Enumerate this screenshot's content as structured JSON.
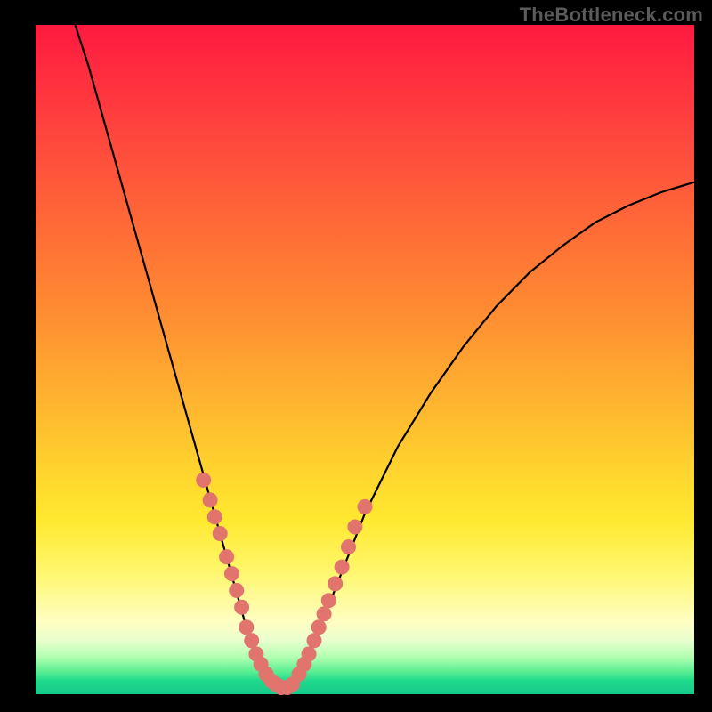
{
  "watermark": "TheBottleneck.com",
  "colors": {
    "background": "#000000",
    "curve": "#000000",
    "dot": "#e2746e"
  },
  "chart_data": {
    "type": "line",
    "title": "",
    "xlabel": "",
    "ylabel": "",
    "xlim": [
      0,
      100
    ],
    "ylim": [
      0,
      100
    ],
    "grid": false,
    "legend": false,
    "annotations": [
      "TheBottleneck.com"
    ],
    "series": [
      {
        "name": "bottleneck-curve",
        "x": [
          6,
          8,
          10,
          12,
          14,
          16,
          18,
          20,
          22,
          24,
          26,
          28,
          30,
          32,
          33.5,
          35,
          36,
          37,
          38,
          39,
          40,
          42,
          44,
          46,
          48,
          50,
          55,
          60,
          65,
          70,
          75,
          80,
          85,
          90,
          95,
          100
        ],
        "y": [
          100,
          94,
          87,
          80,
          73,
          66,
          59,
          52,
          45,
          38,
          31,
          24,
          17,
          10,
          6,
          3,
          1.5,
          1,
          1,
          1.5,
          3,
          7,
          12,
          17,
          22,
          27,
          37,
          45,
          52,
          58,
          63,
          67,
          70.5,
          73,
          75,
          76.5
        ]
      }
    ],
    "scatter_points": {
      "name": "highlighted-points",
      "x": [
        25.5,
        26.5,
        27.2,
        28.0,
        29.0,
        29.8,
        30.5,
        31.3,
        32.0,
        32.8,
        33.5,
        34.2,
        35.0,
        35.8,
        36.5,
        37.3,
        38.2,
        39.0,
        40.0,
        40.8,
        41.5,
        42.3,
        43.0,
        43.8,
        44.5,
        45.5,
        46.5,
        47.5,
        48.5,
        50.0
      ],
      "y": [
        32,
        29,
        26.5,
        24,
        20.5,
        18,
        15.5,
        13,
        10,
        8,
        6,
        4.5,
        3,
        2,
        1.5,
        1,
        1,
        1.5,
        3,
        4.5,
        6,
        8,
        10,
        12,
        14,
        16.5,
        19,
        22,
        25,
        28
      ]
    }
  }
}
